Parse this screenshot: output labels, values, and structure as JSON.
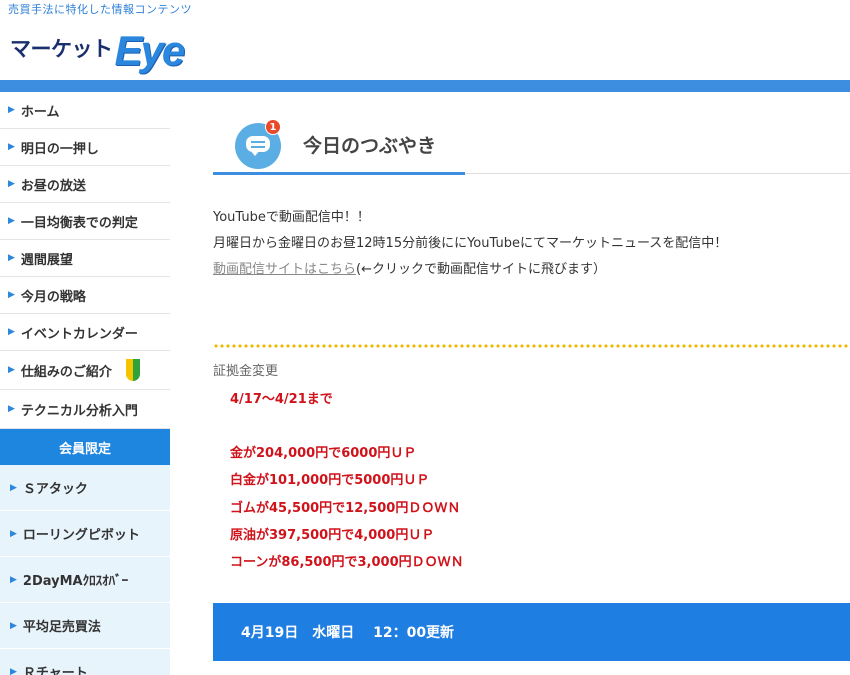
{
  "header": {
    "tagline": "売買手法に特化した情報コンテンツ",
    "logo_text": "マーケット",
    "logo_eye": "Eye"
  },
  "sidebar": {
    "items": [
      {
        "label": "ホーム"
      },
      {
        "label": "明日の一押し"
      },
      {
        "label": "お昼の放送"
      },
      {
        "label": "一目均衡表での判定"
      },
      {
        "label": "週間展望"
      },
      {
        "label": "今月の戦略"
      },
      {
        "label": "イベントカレンダー"
      },
      {
        "label": "仕組みのご紹介"
      },
      {
        "label": "テクニカル分析入門"
      }
    ],
    "members_header": "会員限定",
    "member_items": [
      {
        "label": "Ｓアタック"
      },
      {
        "label": "ローリングピボット"
      },
      {
        "label": "2DayMAｸﾛｽｵﾊﾞｰ"
      },
      {
        "label": "平均足売買法"
      },
      {
        "label": "Ｒチャート"
      }
    ]
  },
  "main": {
    "heading": "今日のつぶやき",
    "badge_count": "1",
    "message": {
      "line1": "YouTubeで動画配信中！！",
      "line2": "月曜日から金曜日のお昼12時15分前後ににYouTubeにてマーケットニュースを配信中！",
      "link_text": "動画配信サイトはこちら",
      "link_suffix": "(←クリックで動画配信サイトに飛びます）"
    },
    "section_label": "証拠金変更",
    "date_range": "4/17～4/21まで",
    "margin_changes": [
      "金が204,000円で6000円ＵＰ",
      "白金が101,000円で5000円ＵＰ",
      "ゴムが45,500円で12,500円ＤＯＷＮ",
      "原油が397,500円で4,000円ＵＰ",
      "コーンが86,500円で3,000円ＤＯＷＮ"
    ],
    "update_bar": "4月19日　水曜日　 12：00更新"
  },
  "colors": {
    "accent_blue": "#3d8ee0",
    "update_bar_blue": "#1f7ee2",
    "alert_red": "#d0121b",
    "dotted_yellow": "#f0b800"
  }
}
